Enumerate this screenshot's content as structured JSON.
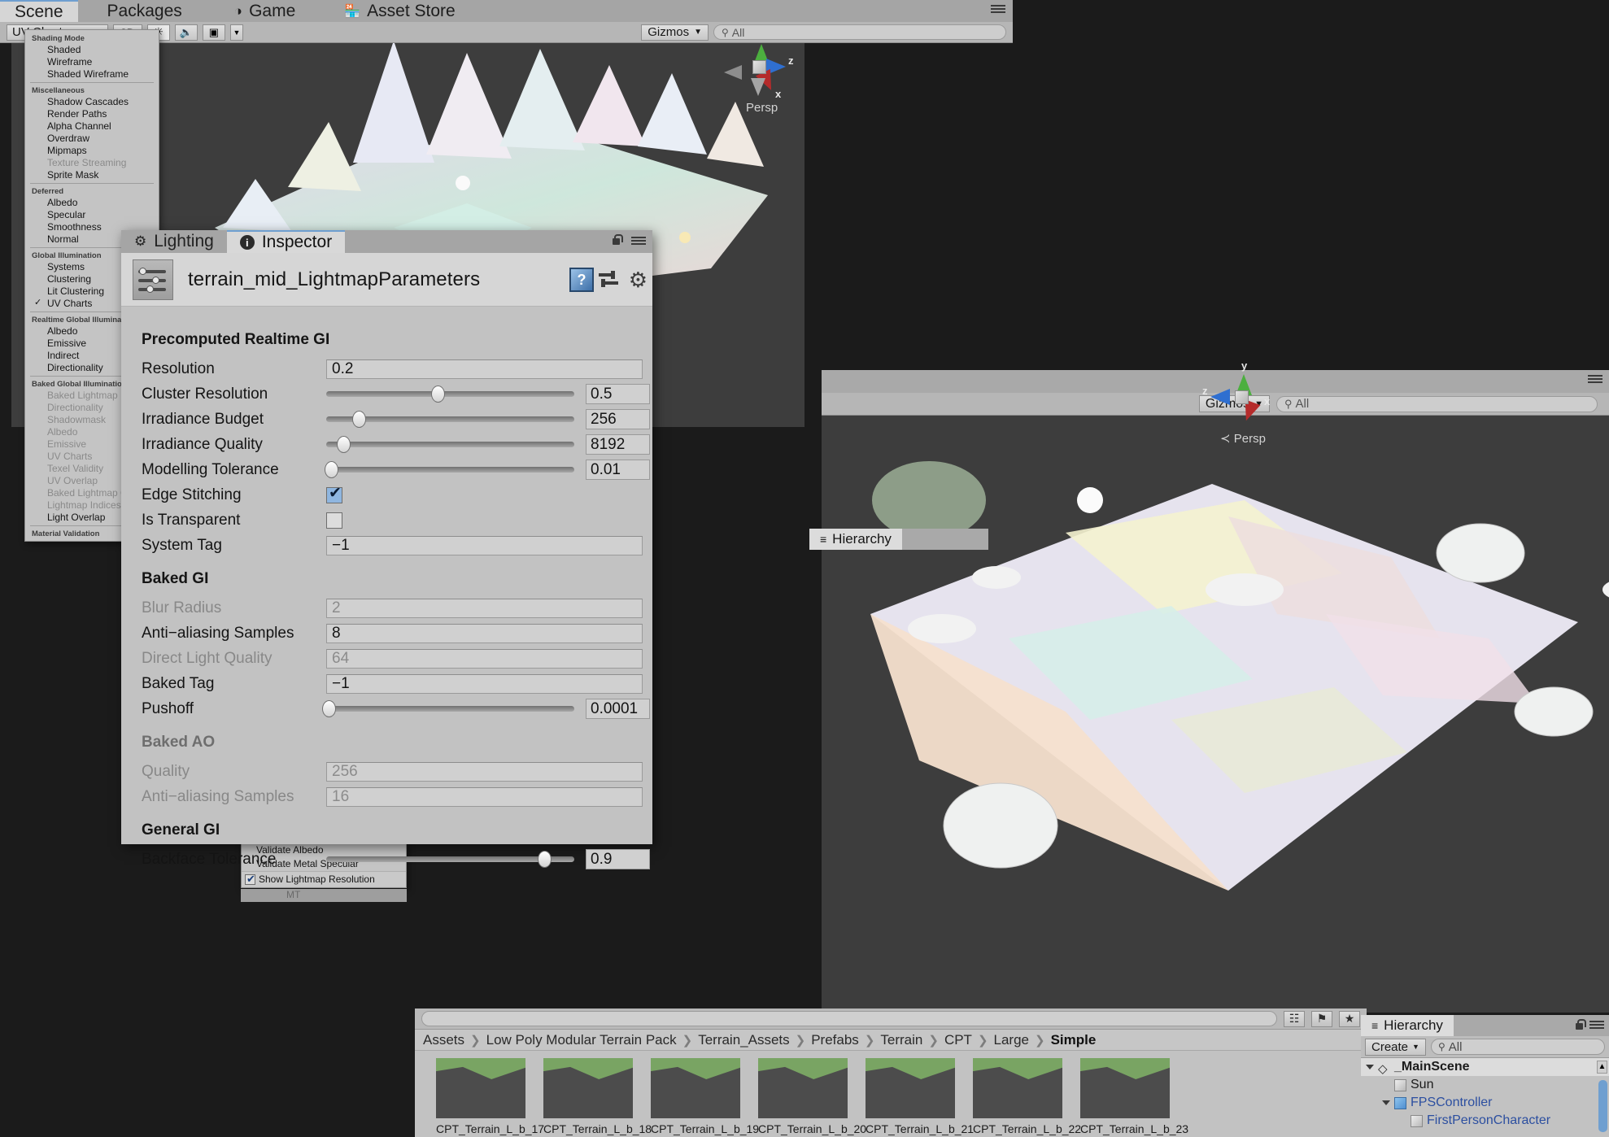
{
  "app": {
    "name": "Unity Editor"
  },
  "top_tabs": [
    {
      "label": "Scene",
      "icon": "",
      "active": true
    },
    {
      "label": "Packages",
      "icon": "",
      "active": false
    },
    {
      "label": "Game",
      "icon": "game-icon",
      "active": false
    },
    {
      "label": "Asset Store",
      "icon": "store-icon",
      "active": false
    }
  ],
  "scene_toolbar": {
    "draw_mode": "UV Charts",
    "two_d": "2D",
    "lighting_icon": "sun-icon",
    "audio_icon": "speaker-icon",
    "effects_icon": "image-icon",
    "gizmos_label": "Gizmos",
    "search_placeholder": "All",
    "search_icon": "search-icon"
  },
  "shading_menu": {
    "groups": [
      {
        "label": "Shading Mode",
        "items": [
          {
            "label": "Shaded",
            "dim": false,
            "checked": false
          },
          {
            "label": "Wireframe",
            "dim": false,
            "checked": false
          },
          {
            "label": "Shaded Wireframe",
            "dim": false,
            "checked": false
          }
        ]
      },
      {
        "label": "Miscellaneous",
        "items": [
          {
            "label": "Shadow Cascades",
            "dim": false,
            "checked": false
          },
          {
            "label": "Render Paths",
            "dim": false,
            "checked": false
          },
          {
            "label": "Alpha Channel",
            "dim": false,
            "checked": false
          },
          {
            "label": "Overdraw",
            "dim": false,
            "checked": false
          },
          {
            "label": "Mipmaps",
            "dim": false,
            "checked": false
          },
          {
            "label": "Texture Streaming",
            "dim": true,
            "checked": false
          },
          {
            "label": "Sprite Mask",
            "dim": false,
            "checked": false
          }
        ]
      },
      {
        "label": "Deferred",
        "items": [
          {
            "label": "Albedo",
            "dim": false,
            "checked": false
          },
          {
            "label": "Specular",
            "dim": false,
            "checked": false
          },
          {
            "label": "Smoothness",
            "dim": false,
            "checked": false
          },
          {
            "label": "Normal",
            "dim": false,
            "checked": false
          }
        ]
      },
      {
        "label": "Global Illumination",
        "items": [
          {
            "label": "Systems",
            "dim": false,
            "checked": false
          },
          {
            "label": "Clustering",
            "dim": false,
            "checked": false
          },
          {
            "label": "Lit Clustering",
            "dim": false,
            "checked": false
          },
          {
            "label": "UV Charts",
            "dim": false,
            "checked": true
          }
        ]
      },
      {
        "label": "Realtime Global Illumination",
        "items": [
          {
            "label": "Albedo",
            "dim": false,
            "checked": false
          },
          {
            "label": "Emissive",
            "dim": false,
            "checked": false
          },
          {
            "label": "Indirect",
            "dim": false,
            "checked": false
          },
          {
            "label": "Directionality",
            "dim": false,
            "checked": false
          }
        ]
      },
      {
        "label": "Baked Global Illumination",
        "items": [
          {
            "label": "Baked Lightmap",
            "dim": true,
            "checked": false
          },
          {
            "label": "Directionality",
            "dim": true,
            "checked": false
          },
          {
            "label": "Shadowmask",
            "dim": true,
            "checked": false
          },
          {
            "label": "Albedo",
            "dim": true,
            "checked": false
          },
          {
            "label": "Emissive",
            "dim": true,
            "checked": false
          },
          {
            "label": "UV Charts",
            "dim": true,
            "checked": false
          },
          {
            "label": "Texel Validity",
            "dim": true,
            "checked": false
          },
          {
            "label": "UV Overlap",
            "dim": true,
            "checked": false
          },
          {
            "label": "Baked Lightmap Culling",
            "dim": true,
            "checked": false
          },
          {
            "label": "Lightmap Indices",
            "dim": true,
            "checked": false
          },
          {
            "label": "Light Overlap",
            "dim": false,
            "checked": false
          }
        ]
      },
      {
        "label": "Material Validation",
        "items": []
      }
    ]
  },
  "validation_menu": {
    "items": [
      {
        "label": "Validate Albedo"
      },
      {
        "label": "Validate Metal Specular"
      }
    ],
    "toggle": {
      "label": "Show Lightmap Resolution",
      "checked": true
    }
  },
  "inspector": {
    "tabs": [
      {
        "label": "Lighting",
        "icon": "lighting-icon",
        "active": false
      },
      {
        "label": "Inspector",
        "icon": "info-icon",
        "active": true
      }
    ],
    "lock_icon": "lock-icon",
    "menu_icon": "hamburger-icon",
    "asset_title": "terrain_mid_LightmapParameters",
    "asset_icon": "lightmap-parameters-icon",
    "header_buttons": [
      {
        "name": "help-button",
        "glyph": "?"
      },
      {
        "name": "preset-button",
        "glyph": "preset"
      },
      {
        "name": "settings-button",
        "glyph": "gear"
      }
    ],
    "sections": [
      {
        "title": "Precomputed Realtime GI",
        "dim": false,
        "fields": [
          {
            "label": "Resolution",
            "type": "text",
            "value": "0.2",
            "dim": false
          },
          {
            "label": "Cluster Resolution",
            "type": "slider",
            "value": "0.5",
            "pct": 45,
            "dim": false
          },
          {
            "label": "Irradiance Budget",
            "type": "slider",
            "value": "256",
            "pct": 13,
            "dim": false
          },
          {
            "label": "Irradiance Quality",
            "type": "slider",
            "value": "8192",
            "pct": 7,
            "dim": false
          },
          {
            "label": "Modelling Tolerance",
            "type": "slider",
            "value": "0.01",
            "pct": 2,
            "dim": false
          },
          {
            "label": "Edge Stitching",
            "type": "checkbox",
            "value": true,
            "dim": false
          },
          {
            "label": "Is Transparent",
            "type": "checkbox",
            "value": false,
            "dim": false
          },
          {
            "label": "System Tag",
            "type": "text",
            "value": "−1",
            "dim": false
          }
        ]
      },
      {
        "title": "Baked GI",
        "dim": false,
        "fields": [
          {
            "label": "Blur Radius",
            "type": "text",
            "value": "2",
            "dim": true
          },
          {
            "label": "Anti−aliasing Samples",
            "type": "text",
            "value": "8",
            "dim": false
          },
          {
            "label": "Direct Light Quality",
            "type": "text",
            "value": "64",
            "dim": true
          },
          {
            "label": "Baked Tag",
            "type": "text",
            "value": "−1",
            "dim": false
          },
          {
            "label": "Pushoff",
            "type": "slider",
            "value": "0.0001",
            "pct": 1,
            "dim": false
          }
        ]
      },
      {
        "title": "Baked AO",
        "dim": true,
        "fields": [
          {
            "label": "Quality",
            "type": "text",
            "value": "256",
            "dim": true
          },
          {
            "label": "Anti−aliasing Samples",
            "type": "text",
            "value": "16",
            "dim": true
          }
        ]
      },
      {
        "title": "General GI",
        "dim": false,
        "fields": [
          {
            "label": "Backface Tolerance",
            "type": "slider",
            "value": "0.9",
            "pct": 88,
            "dim": false
          }
        ]
      }
    ]
  },
  "scene_views": [
    {
      "name": "scene-view-top",
      "gizmo_axes": [
        "y",
        "z",
        "x"
      ],
      "persp_label": "Persp"
    },
    {
      "name": "scene-view-bottom",
      "gizmo_axes": [
        "y",
        "z",
        "x"
      ],
      "persp_label": "Persp",
      "gizmos_label": "Gizmos",
      "search_placeholder": "All"
    }
  ],
  "hierarchy_floating": {
    "tab_label": "Hierarchy",
    "icon": "hierarchy-icon"
  },
  "hierarchy": {
    "tab_label": "Hierarchy",
    "icon": "hierarchy-icon",
    "create_label": "Create",
    "search_placeholder": "All",
    "rows": [
      {
        "label": "_MainScene",
        "depth": 0,
        "expanded": true,
        "icon": "unity-scene-icon",
        "blue": false,
        "selected": true
      },
      {
        "label": "Sun",
        "depth": 1,
        "expanded": false,
        "icon": "cube-icon",
        "blue": false,
        "selected": false
      },
      {
        "label": "FPSController",
        "depth": 1,
        "expanded": true,
        "icon": "prefab-cube-icon",
        "blue": true,
        "selected": false
      },
      {
        "label": "FirstPersonCharacter",
        "depth": 2,
        "expanded": false,
        "icon": "cube-icon",
        "blue": true,
        "selected": false
      }
    ]
  },
  "project": {
    "search_placeholder": "",
    "search_icon": "search-icon",
    "toolbar_icons": [
      "new-folder-icon",
      "label-icon",
      "favorite-icon"
    ],
    "breadcrumb": [
      "Assets",
      "Low Poly Modular Terrain Pack",
      "Terrain_Assets",
      "Prefabs",
      "Terrain",
      "CPT",
      "Large",
      "Simple"
    ],
    "items": [
      {
        "label": "CPT_Terrain_L_b_17"
      },
      {
        "label": "CPT_Terrain_L_b_18"
      },
      {
        "label": "CPT_Terrain_L_b_19"
      },
      {
        "label": "CPT_Terrain_L_b_20"
      },
      {
        "label": "CPT_Terrain_L_b_21"
      },
      {
        "label": "CPT_Terrain_L_b_22"
      },
      {
        "label": "CPT_Terrain_L_b_23"
      }
    ]
  },
  "colors": {
    "panel": "#c2c2c2",
    "tabbar": "#a5a5a5",
    "active_tab": "#d8d8d8",
    "accent_blue": "#6f9fd0",
    "scene_bg": "#3d3d3d",
    "text": "#161616",
    "text_dim": "#8a8a8a",
    "hierarchy_blue": "#2c4fa0"
  }
}
